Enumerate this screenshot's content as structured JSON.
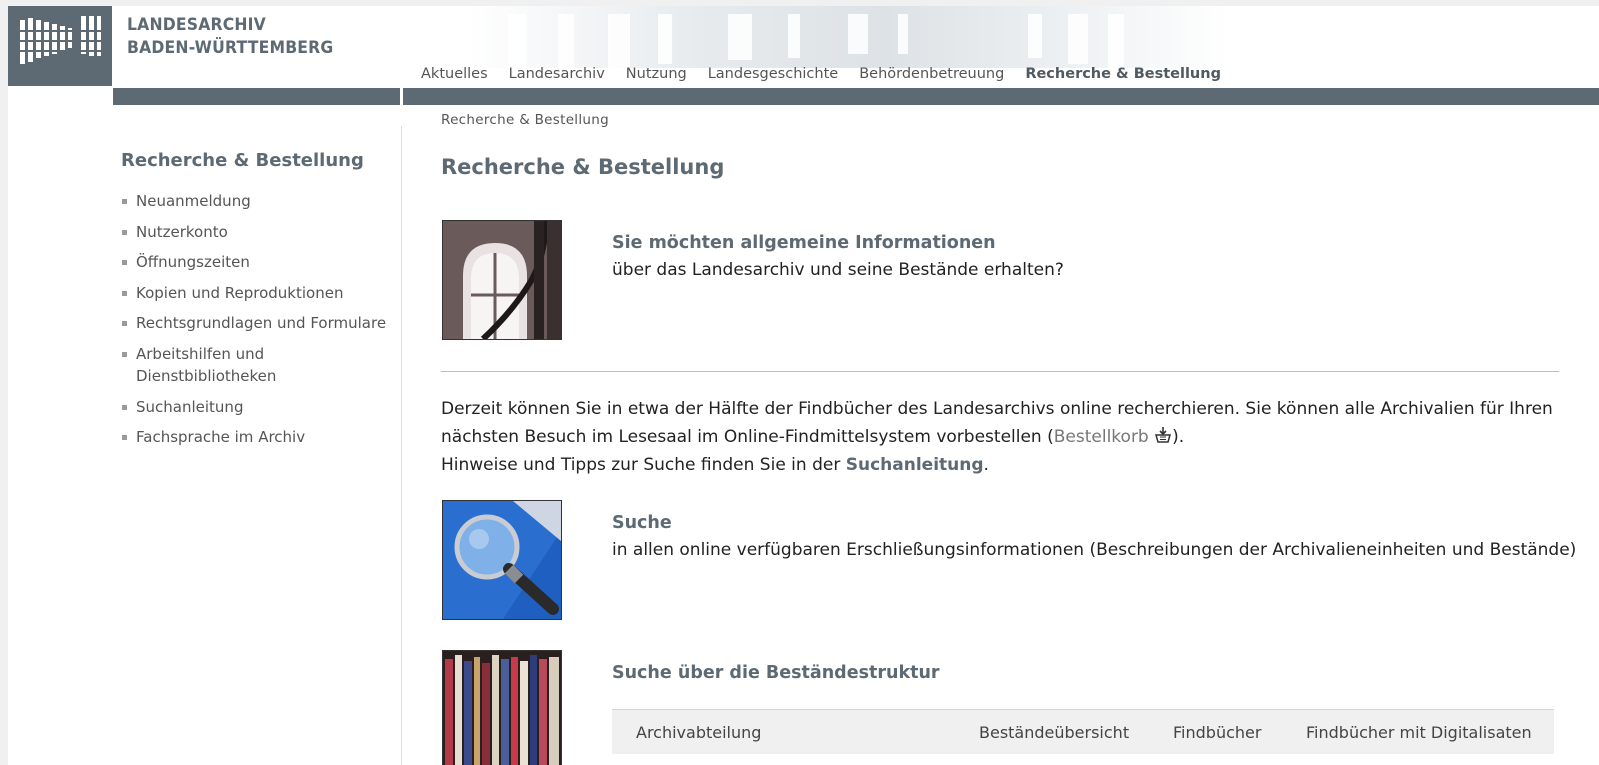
{
  "brand": {
    "line1": "LANDESARCHIV",
    "line2": "BADEN-WÜRTTEMBERG"
  },
  "topnav": [
    {
      "label": "Aktuelles"
    },
    {
      "label": "Landesarchiv"
    },
    {
      "label": "Nutzung"
    },
    {
      "label": "Landesgeschichte"
    },
    {
      "label": "Behördenbetreuung"
    },
    {
      "label": "Recherche & Bestellung",
      "active": true
    }
  ],
  "sidebar": {
    "title": "Recherche & Bestellung",
    "items": [
      {
        "label": "Neuanmeldung"
      },
      {
        "label": "Nutzerkonto"
      },
      {
        "label": "Öffnungszeiten"
      },
      {
        "label": "Kopien und Reproduktionen"
      },
      {
        "label": "Rechtsgrundlagen und Formulare"
      },
      {
        "label": "Arbeitshilfen und Dienstbibliotheken"
      },
      {
        "label": "Suchanleitung"
      },
      {
        "label": "Fachsprache im Archiv"
      }
    ]
  },
  "main": {
    "breadcrumb": "Recherche & Bestellung",
    "title": "Recherche & Bestellung",
    "info_block": {
      "title": "Sie möchten allgemeine Informationen",
      "text": "über das Landesarchiv und seine Bestände erhalten?"
    },
    "intro": {
      "part1": "Derzeit können Sie in etwa der Hälfte der Findbücher des Landesarchivs online recherchieren. Sie können alle Archivalien für Ihren nächsten Besuch im Lesesaal im Online-Findmittelsystem vorbestellen (",
      "basket_link": "Bestellkorb",
      "part2": ").",
      "part3": "Hinweise und Tipps zur Suche finden Sie in der ",
      "guide_link": "Suchanleitung",
      "part4": "."
    },
    "search_block": {
      "title": "Suche",
      "text": "in allen online verfügbaren Erschließungsinformationen (Beschreibungen der Archivalieneinheiten und Bestände)"
    },
    "structure_block": {
      "title": "Suche über die Beständestruktur"
    },
    "table_headers": [
      "Archivabteilung",
      "Beständeübersicht",
      "Findbücher",
      "Findbücher mit Digitalisaten"
    ]
  },
  "colors": {
    "brand_grey": "#5d6a73",
    "band": "#5d6a73",
    "link_grey": "#777777"
  }
}
